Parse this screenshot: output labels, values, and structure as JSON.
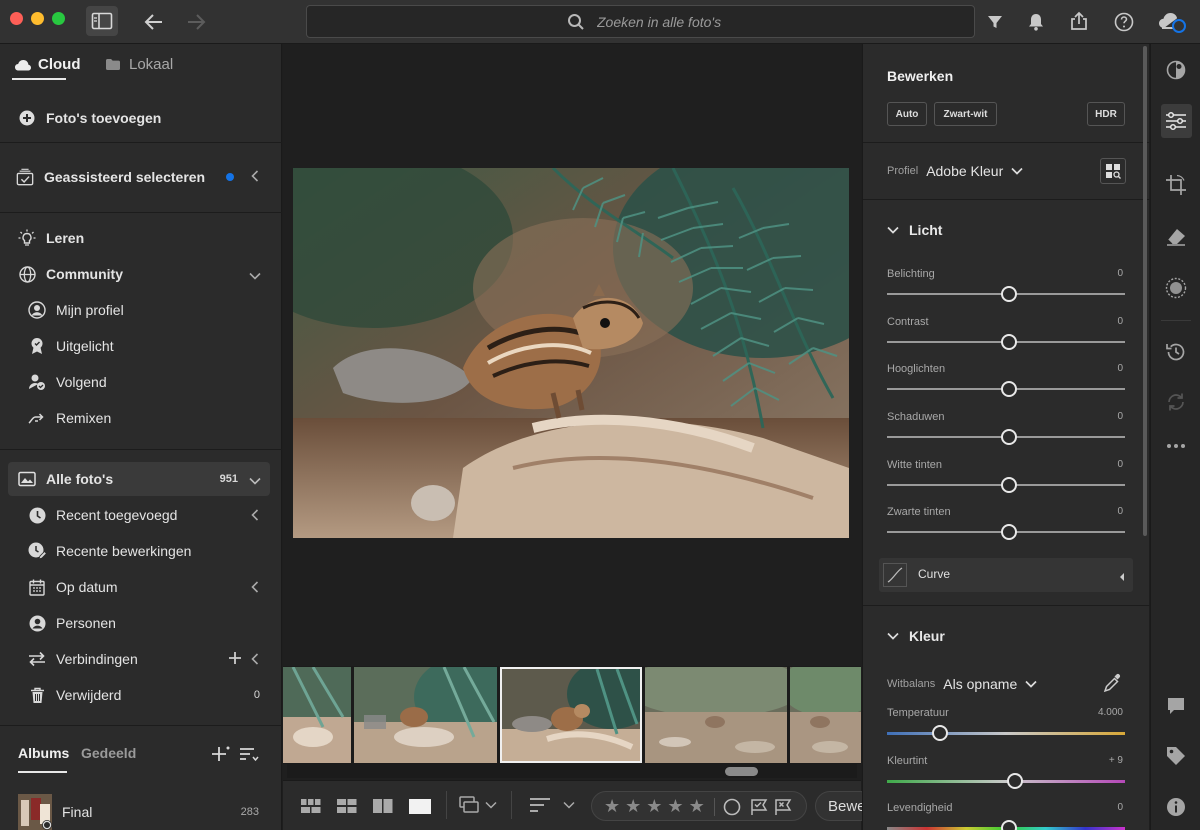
{
  "search": {
    "placeholder": "Zoeken in alle foto's"
  },
  "sidebar": {
    "tabs": [
      {
        "label": "Cloud"
      },
      {
        "label": "Lokaal"
      }
    ],
    "add_photos": "Foto's toevoegen",
    "assisted_select": "Geassisteerd selecteren",
    "learn": "Leren",
    "community": "Community",
    "community_items": [
      {
        "label": "Mijn profiel"
      },
      {
        "label": "Uitgelicht"
      },
      {
        "label": "Volgend"
      },
      {
        "label": "Remixen"
      }
    ],
    "all_photos": {
      "label": "Alle foto's",
      "count": "951"
    },
    "library_items": [
      {
        "label": "Recent toegevoegd"
      },
      {
        "label": "Recente bewerkingen"
      },
      {
        "label": "Op datum"
      },
      {
        "label": "Personen"
      },
      {
        "label": "Verbindingen"
      },
      {
        "label": "Verwijderd",
        "count": "0"
      }
    ],
    "album_tabs": [
      {
        "label": "Albums"
      },
      {
        "label": "Gedeeld"
      }
    ],
    "albums": [
      {
        "name": "Final",
        "count": "283"
      }
    ]
  },
  "bottombar": {
    "edit_label": "Bewe"
  },
  "panel": {
    "title": "Bewerken",
    "buttons": {
      "auto": "Auto",
      "bw": "Zwart-wit",
      "hdr": "HDR"
    },
    "profile": {
      "label": "Profiel",
      "value": "Adobe Kleur"
    },
    "light": {
      "title": "Licht",
      "sliders": [
        {
          "label": "Belichting",
          "value": "0"
        },
        {
          "label": "Contrast",
          "value": "0"
        },
        {
          "label": "Hooglichten",
          "value": "0"
        },
        {
          "label": "Schaduwen",
          "value": "0"
        },
        {
          "label": "Witte tinten",
          "value": "0"
        },
        {
          "label": "Zwarte tinten",
          "value": "0"
        }
      ],
      "curve": "Curve"
    },
    "color": {
      "title": "Kleur",
      "whitebalance": {
        "label": "Witbalans",
        "value": "Als opname"
      },
      "temperature": {
        "label": "Temperatuur",
        "value": "4.000"
      },
      "tint": {
        "label": "Kleurtint",
        "value": "+ 9"
      },
      "vibrance": {
        "label": "Levendigheid",
        "value": "0"
      }
    }
  },
  "colors": {
    "accent_blue": "#1473e6",
    "panel_bg": "#2b2b2b",
    "selected_row": "#3a3a3a"
  }
}
